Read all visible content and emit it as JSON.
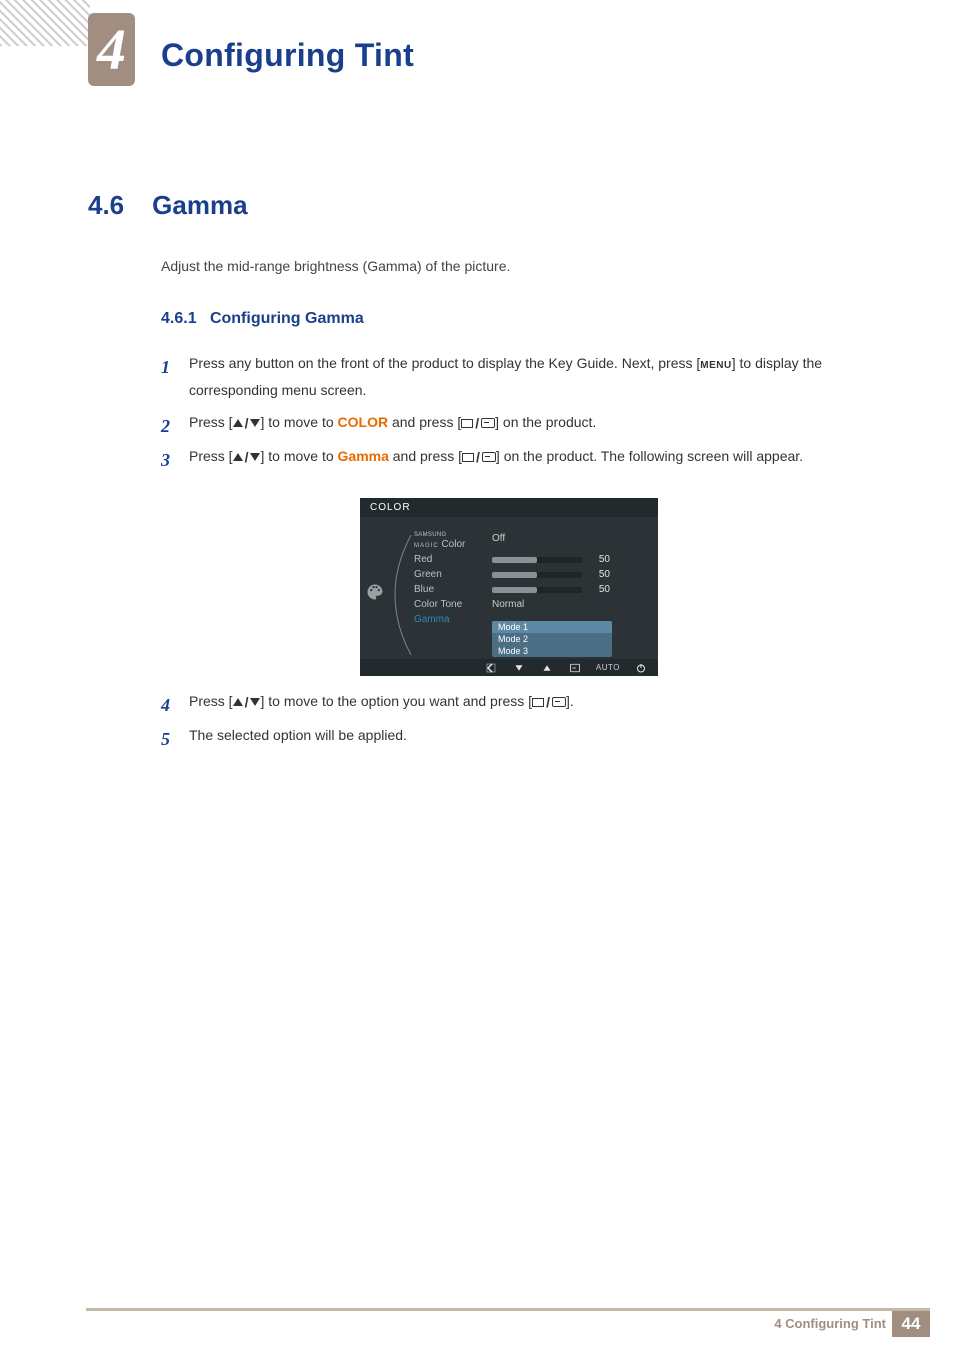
{
  "chapter": {
    "num": "4",
    "title": "Configuring Tint"
  },
  "section": {
    "num": "4.6",
    "title": "Gamma"
  },
  "intro": "Adjust the mid-range brightness (Gamma) of the picture.",
  "subsection": {
    "num": "4.6.1",
    "title": "Configuring Gamma"
  },
  "steps": {
    "s1": {
      "n": "1",
      "a": "Press any button on the front of the product to display the Key Guide. Next, press [",
      "menu": "MENU",
      "b": "] to display the corresponding menu screen."
    },
    "s2": {
      "n": "2",
      "a": "Press [",
      "b": "] to move to ",
      "hl": "COLOR",
      "c": " and press [",
      "d": "] on the product."
    },
    "s3": {
      "n": "3",
      "a": "Press [",
      "b": "] to move to ",
      "hl": "Gamma",
      "c": " and press [",
      "d": "] on the product. The following screen will appear."
    },
    "s4": {
      "n": "4",
      "a": "Press [",
      "b": "] to move to the option you want and press [",
      "c": "]."
    },
    "s5": {
      "n": "5",
      "a": "The selected option will be applied."
    }
  },
  "osd": {
    "title": "COLOR",
    "magic_a": "SAMSUNG",
    "magic_b": "MAGIC",
    "magic_c": "Color",
    "magic_val": "Off",
    "rows": {
      "red": {
        "label": "Red",
        "val": "50"
      },
      "green": {
        "label": "Green",
        "val": "50"
      },
      "blue": {
        "label": "Blue",
        "val": "50"
      }
    },
    "colortone": {
      "label": "Color Tone",
      "val": "Normal"
    },
    "gamma_label": "Gamma",
    "gamma_opts": {
      "m1": "Mode 1",
      "m2": "Mode 2",
      "m3": "Mode 3"
    },
    "foot_auto": "AUTO"
  },
  "footer": {
    "text": "4 Configuring Tint",
    "page": "44"
  }
}
